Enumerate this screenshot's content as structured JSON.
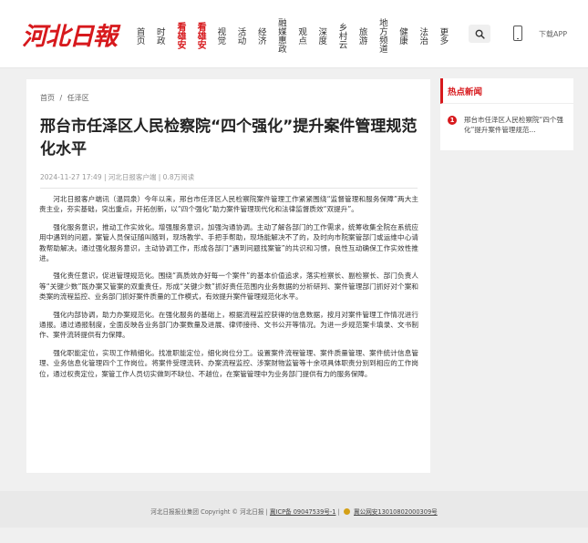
{
  "header": {
    "logo": "河北日報",
    "nav": [
      {
        "label": "首页",
        "style": "normal"
      },
      {
        "label": "时政",
        "style": "normal"
      },
      {
        "label": "看雄安",
        "style": "red"
      },
      {
        "label": "看雄安",
        "style": "red"
      },
      {
        "label": "视觉",
        "style": "normal"
      },
      {
        "label": "活动",
        "style": "normal"
      },
      {
        "label": "经济",
        "style": "normal"
      },
      {
        "label": "融媒惠政",
        "style": "normal"
      },
      {
        "label": "观点",
        "style": "normal"
      },
      {
        "label": "深度",
        "style": "normal"
      },
      {
        "label": "乡村云",
        "style": "normal"
      },
      {
        "label": "旅游",
        "style": "normal"
      },
      {
        "label": "地方频道",
        "style": "normal"
      },
      {
        "label": "健康",
        "style": "normal"
      },
      {
        "label": "法治",
        "style": "normal"
      },
      {
        "label": "更多",
        "style": "normal"
      }
    ],
    "download_label": "下载APP"
  },
  "breadcrumb": [
    "首页",
    "/",
    "任泽区"
  ],
  "article": {
    "title": "邢台市任泽区人民检察院“四个强化”提升案件管理规范化水平",
    "meta": "2024-11-27 17:49 | 河北日报客户端 | 0.8万阅读",
    "paragraphs": [
      "河北日报客户端讯（温同泉）今年以来，邢台市任泽区人民检察院案件管理工作紧紧围绕“监督管理和服务保障”两大主责主业，夯实基础，突出重点，开拓创新，以“四个强化”助力案件管理现代化和法律监督质效“双提升”。",
      "强化服务意识，推动工作实效化。增强服务意识，加强沟通协调。主动了解各部门的工作需求，统筹收集全院在系统应用中遇到的问题，案管人员保证随叫随到，现场教学、手把手帮助，现场能解决不了的，及时向市院案管部门或运维中心请教帮助解决。通过强化服务意识，主动协调工作，形成各部门“遇到问题找案管”的共识和习惯，良性互动确保工作实效性推进。",
      "强化责任意识，促进管理规范化。围绕“高质效办好每一个案件”的基本价值追求，落实检察长、副检察长、部门负责人等“关键少数”既办案又管案的双重责任，形成“关键少数”抓好责任范围内业务数据的分析研判、案件管理部门抓好对个案和类案的流程监控、业务部门抓好案件质量的工作模式，有效提升案件管理规范化水平。",
      "强化内部协调，助力办案规范化。在强化服务的基础上，根据流程监控获得的信息数据，按月对案件管理工作情况进行通报。通过通报制度，全面反映各业务部门办案数量及进展、律师接待、文书公开等情况。为进一步规范案卡填录、文书制作、案件流转提供有力保障。",
      "强化职能定位，实现工作精细化。找准职能定位，细化岗位分工。设置案件流程管理、案件质量管理、案件统计信息管理、业务信息化管理四个工作岗位。将案件受理流转、办案流程监控、涉案财物监管等十余项具体职责分别到相应的工作岗位，通过权责定位，案管工作人员切实做到不缺位、不越位，在案管管理中为业务部门提供有力的服务保障。"
    ]
  },
  "sidebar": {
    "heading": "热点新闻",
    "items": [
      {
        "num": "1",
        "text": "邢台市任泽区人民检察院“四个强化”提升案件管理规范..."
      }
    ]
  },
  "footer": {
    "company": "河北日报报业集团 Copyright © 河北日报 |",
    "icp": "冀ICP备 09047539号-1",
    "sep": "|",
    "police": "冀公网安13010802000309号"
  },
  "colors": {
    "brand_red": "#d7191d",
    "footer_bg": "#e9e9e9",
    "page_bg": "#f0f0f0"
  }
}
